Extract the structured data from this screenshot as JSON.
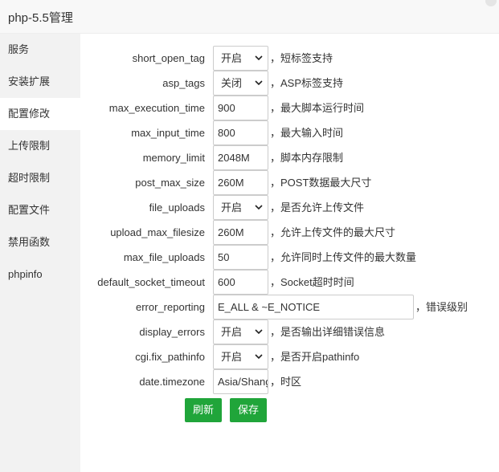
{
  "window": {
    "title": "php-5.5管理"
  },
  "sidebar": {
    "items": [
      {
        "label": "服务"
      },
      {
        "label": "安装扩展"
      },
      {
        "label": "配置修改",
        "active": true
      },
      {
        "label": "上传限制"
      },
      {
        "label": "超时限制"
      },
      {
        "label": "配置文件"
      },
      {
        "label": "禁用函数"
      },
      {
        "label": "phpinfo"
      }
    ]
  },
  "form": {
    "rows": [
      {
        "label": "short_open_tag",
        "type": "select",
        "value": "开启",
        "desc": "，短标签支持"
      },
      {
        "label": "asp_tags",
        "type": "select",
        "value": "关闭",
        "desc": "，ASP标签支持"
      },
      {
        "label": "max_execution_time",
        "type": "input",
        "value": "900",
        "desc": "，最大脚本运行时间"
      },
      {
        "label": "max_input_time",
        "type": "input",
        "value": "800",
        "desc": "，最大输入时间"
      },
      {
        "label": "memory_limit",
        "type": "input",
        "value": "2048M",
        "desc": "，脚本内存限制"
      },
      {
        "label": "post_max_size",
        "type": "input",
        "value": "260M",
        "desc": "，POST数据最大尺寸"
      },
      {
        "label": "file_uploads",
        "type": "select",
        "value": "开启",
        "desc": "，是否允许上传文件"
      },
      {
        "label": "upload_max_filesize",
        "type": "input",
        "value": "260M",
        "desc": "，允许上传文件的最大尺寸"
      },
      {
        "label": "max_file_uploads",
        "type": "input",
        "value": "50",
        "desc": "，允许同时上传文件的最大数量"
      },
      {
        "label": "default_socket_timeout",
        "type": "input",
        "value": "600",
        "desc": "，Socket超时时间"
      },
      {
        "label": "error_reporting",
        "type": "wide",
        "value": "E_ALL & ~E_NOTICE",
        "desc": "，错误级别"
      },
      {
        "label": "display_errors",
        "type": "select",
        "value": "开启",
        "desc": "，是否输出详细错误信息"
      },
      {
        "label": "cgi.fix_pathinfo",
        "type": "select",
        "value": "开启",
        "desc": "，是否开启pathinfo"
      },
      {
        "label": "date.timezone",
        "type": "input",
        "value": "Asia/Shanghai",
        "desc": "，时区"
      }
    ]
  },
  "buttons": {
    "refresh_label": "刷新",
    "save_label": "保存"
  },
  "colors": {
    "primary": "#20a53a",
    "sidebar_bg": "#f2f2f2"
  }
}
